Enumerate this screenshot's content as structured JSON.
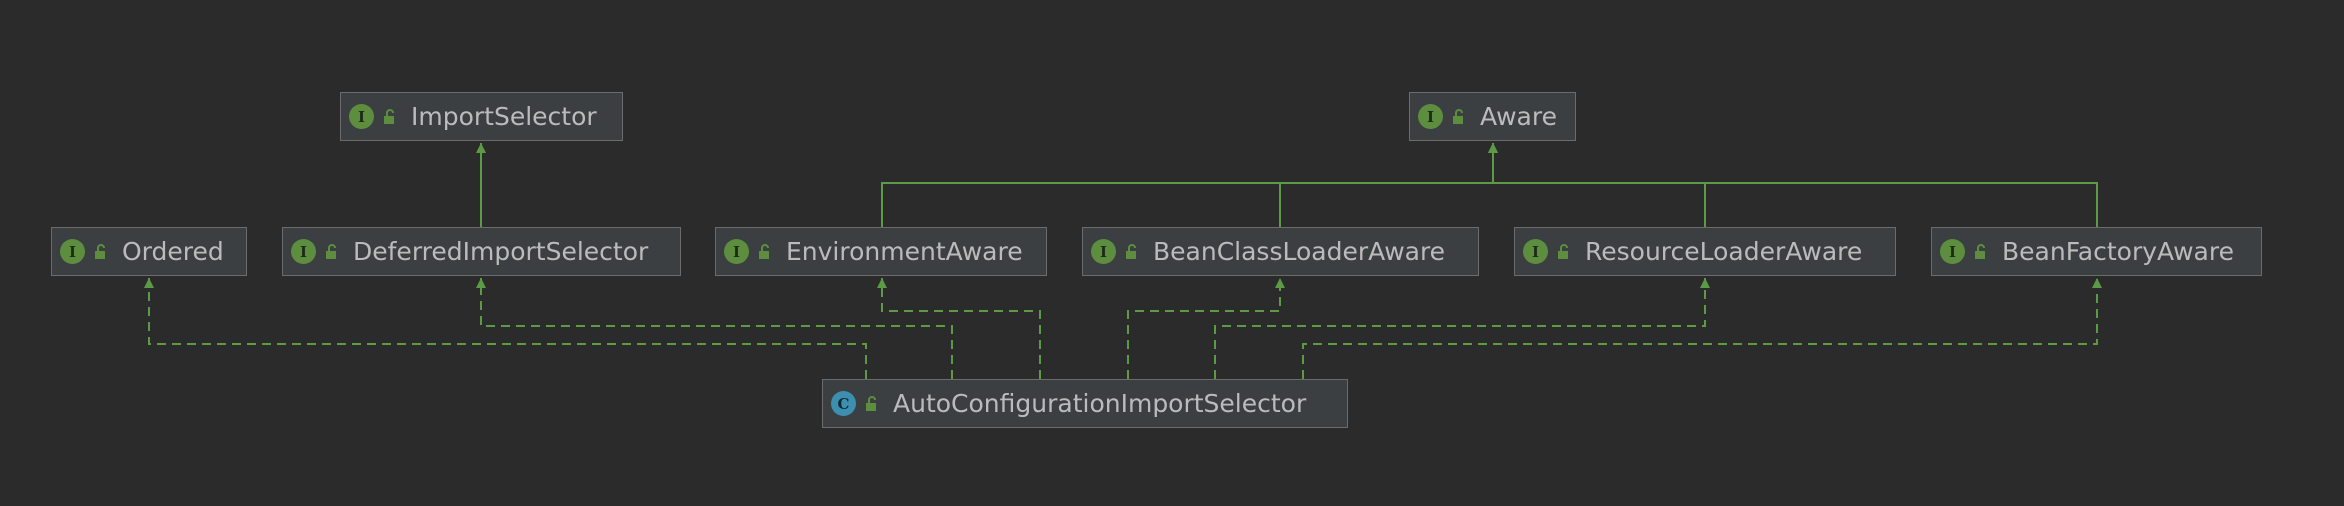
{
  "diagram": {
    "colors": {
      "background": "#2b2b2b",
      "node_fill": "#3c3f41",
      "node_border": "#6b6b6b",
      "edge": "#5d9a45",
      "text": "#bbbbbb",
      "interface_badge": "#5d8d3f",
      "class_badge": "#3c8fb0"
    },
    "nodes": {
      "import_selector": {
        "label": "ImportSelector",
        "kind": "interface",
        "badge": "I"
      },
      "aware": {
        "label": "Aware",
        "kind": "interface",
        "badge": "I"
      },
      "ordered": {
        "label": "Ordered",
        "kind": "interface",
        "badge": "I"
      },
      "deferred_import_selector": {
        "label": "DeferredImportSelector",
        "kind": "interface",
        "badge": "I"
      },
      "environment_aware": {
        "label": "EnvironmentAware",
        "kind": "interface",
        "badge": "I"
      },
      "bean_class_loader_aware": {
        "label": "BeanClassLoaderAware",
        "kind": "interface",
        "badge": "I"
      },
      "resource_loader_aware": {
        "label": "ResourceLoaderAware",
        "kind": "interface",
        "badge": "I"
      },
      "bean_factory_aware": {
        "label": "BeanFactoryAware",
        "kind": "interface",
        "badge": "I"
      },
      "auto_configuration_import_selector": {
        "label": "AutoConfigurationImportSelector",
        "kind": "class",
        "badge": "C"
      }
    },
    "edges": [
      {
        "from": "deferred_import_selector",
        "to": "import_selector",
        "relation": "extends",
        "style": "solid"
      },
      {
        "from": "environment_aware",
        "to": "aware",
        "relation": "extends",
        "style": "solid"
      },
      {
        "from": "bean_class_loader_aware",
        "to": "aware",
        "relation": "extends",
        "style": "solid"
      },
      {
        "from": "resource_loader_aware",
        "to": "aware",
        "relation": "extends",
        "style": "solid"
      },
      {
        "from": "bean_factory_aware",
        "to": "aware",
        "relation": "extends",
        "style": "solid"
      },
      {
        "from": "auto_configuration_import_selector",
        "to": "ordered",
        "relation": "implements",
        "style": "dashed"
      },
      {
        "from": "auto_configuration_import_selector",
        "to": "deferred_import_selector",
        "relation": "implements",
        "style": "dashed"
      },
      {
        "from": "auto_configuration_import_selector",
        "to": "environment_aware",
        "relation": "implements",
        "style": "dashed"
      },
      {
        "from": "auto_configuration_import_selector",
        "to": "bean_class_loader_aware",
        "relation": "implements",
        "style": "dashed"
      },
      {
        "from": "auto_configuration_import_selector",
        "to": "resource_loader_aware",
        "relation": "implements",
        "style": "dashed"
      },
      {
        "from": "auto_configuration_import_selector",
        "to": "bean_factory_aware",
        "relation": "implements",
        "style": "dashed"
      }
    ]
  }
}
